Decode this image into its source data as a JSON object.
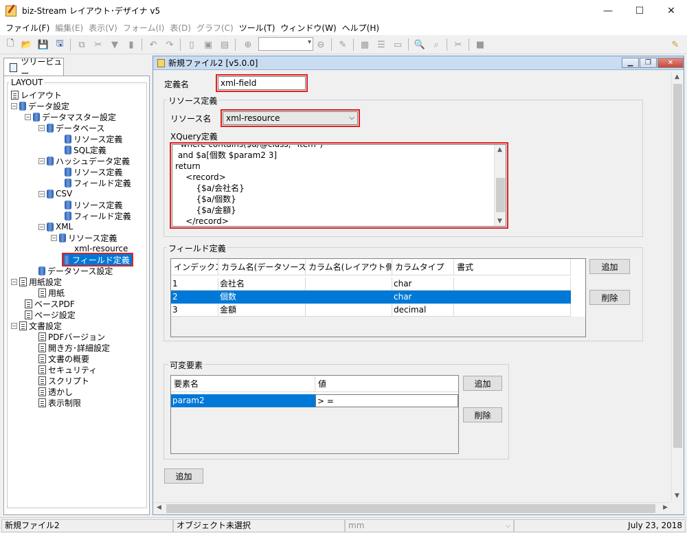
{
  "window": {
    "title": "biz-Stream レイアウト･デザイナ v5",
    "controls": {
      "minimize": "—",
      "maximize": "☐",
      "close": "✕"
    }
  },
  "menu": [
    {
      "label": "ファイル(F)",
      "enabled": true
    },
    {
      "label": "編集(E)",
      "enabled": false
    },
    {
      "label": "表示(V)",
      "enabled": false
    },
    {
      "label": "フォーム(I)",
      "enabled": false
    },
    {
      "label": "表(D)",
      "enabled": false
    },
    {
      "label": "グラフ(C)",
      "enabled": false
    },
    {
      "label": "ツール(T)",
      "enabled": true
    },
    {
      "label": "ウィンドウ(W)",
      "enabled": true
    },
    {
      "label": "ヘルプ(H)",
      "enabled": true
    }
  ],
  "toolbar": {
    "zoom_value": ""
  },
  "left_panel": {
    "tab_label": "ツリービュー",
    "group_label": "LAYOUT",
    "nodes": [
      {
        "label": "レイアウト"
      },
      {
        "label": "データ設定"
      },
      {
        "label": "データマスター設定"
      },
      {
        "label": "データベース"
      },
      {
        "label": "リソース定義"
      },
      {
        "label": "SQL定義"
      },
      {
        "label": "ハッシュデータ定義"
      },
      {
        "label": "リソース定義"
      },
      {
        "label": "フィールド定義"
      },
      {
        "label": "CSV"
      },
      {
        "label": "リソース定義"
      },
      {
        "label": "フィールド定義"
      },
      {
        "label": "XML"
      },
      {
        "label": "リソース定義"
      },
      {
        "label": "xml-resource"
      },
      {
        "label": "フィールド定義"
      },
      {
        "label": "データソース設定"
      },
      {
        "label": "用紙設定"
      },
      {
        "label": "用紙"
      },
      {
        "label": "ベースPDF"
      },
      {
        "label": "ページ設定"
      },
      {
        "label": "文書設定"
      },
      {
        "label": "PDFバージョン"
      },
      {
        "label": "開き方･詳細設定"
      },
      {
        "label": "文書の概要"
      },
      {
        "label": "セキュリティ"
      },
      {
        "label": "スクリプト"
      },
      {
        "label": "透かし"
      },
      {
        "label": "表示制限"
      }
    ]
  },
  "doc_window": {
    "title": "新規ファイル2 [v5.0.0]",
    "def_name_label": "定義名",
    "def_name_value": "xml-field",
    "resource_group_label": "リソース定義",
    "resource_name_label": "リソース名",
    "resource_name_value": "xml-resource",
    "xquery_label": "XQuery定義",
    "xquery_lines": [
      "  where contains($a/@class, \"item\")",
      " and $a[個数 $param2 3]",
      "return",
      "    <record>",
      "        {$a/会社名}",
      "        {$a/個数}",
      "        {$a/金額}",
      "    </record>"
    ],
    "field_group_label": "フィールド定義",
    "field_columns": [
      "インデックス",
      "カラム名(データソース...",
      "カラム名(レイアウト側)",
      "カラムタイプ",
      "書式"
    ],
    "field_rows": [
      [
        "1",
        "会社名",
        "",
        "char",
        ""
      ],
      [
        "2",
        "個数",
        "",
        "char",
        ""
      ],
      [
        "3",
        "金額",
        "",
        "decimal",
        ""
      ]
    ],
    "field_add": "追加",
    "field_delete": "削除",
    "var_group_label": "可変要素",
    "var_columns": [
      "要素名",
      "値"
    ],
    "var_rows": [
      [
        "param2",
        "> ="
      ]
    ],
    "var_add": "追加",
    "var_delete": "削除",
    "bottom_add": "追加"
  },
  "status": {
    "file": "新規ファイル2",
    "object": "オブジェクト未選択",
    "unit": "mm",
    "date": "July 23, 2018"
  }
}
